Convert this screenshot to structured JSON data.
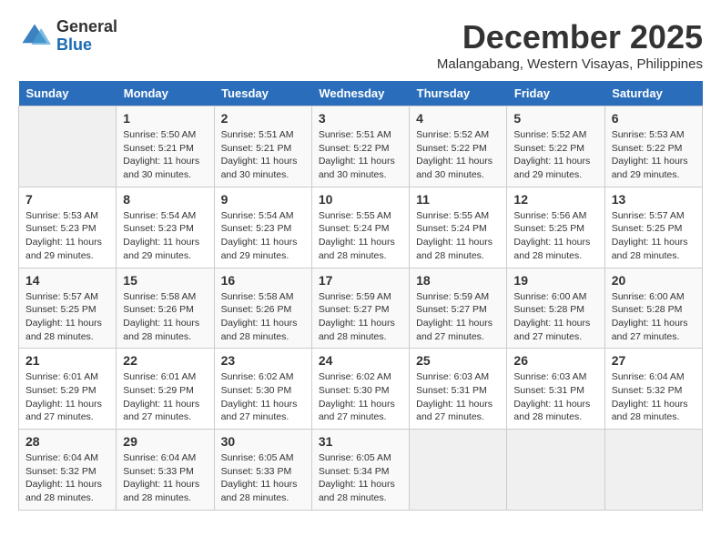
{
  "header": {
    "logo_general": "General",
    "logo_blue": "Blue",
    "month_title": "December 2025",
    "location": "Malangabang, Western Visayas, Philippines"
  },
  "days_of_week": [
    "Sunday",
    "Monday",
    "Tuesday",
    "Wednesday",
    "Thursday",
    "Friday",
    "Saturday"
  ],
  "weeks": [
    [
      {
        "day": "",
        "info": ""
      },
      {
        "day": "1",
        "info": "Sunrise: 5:50 AM\nSunset: 5:21 PM\nDaylight: 11 hours\nand 30 minutes."
      },
      {
        "day": "2",
        "info": "Sunrise: 5:51 AM\nSunset: 5:21 PM\nDaylight: 11 hours\nand 30 minutes."
      },
      {
        "day": "3",
        "info": "Sunrise: 5:51 AM\nSunset: 5:22 PM\nDaylight: 11 hours\nand 30 minutes."
      },
      {
        "day": "4",
        "info": "Sunrise: 5:52 AM\nSunset: 5:22 PM\nDaylight: 11 hours\nand 30 minutes."
      },
      {
        "day": "5",
        "info": "Sunrise: 5:52 AM\nSunset: 5:22 PM\nDaylight: 11 hours\nand 29 minutes."
      },
      {
        "day": "6",
        "info": "Sunrise: 5:53 AM\nSunset: 5:22 PM\nDaylight: 11 hours\nand 29 minutes."
      }
    ],
    [
      {
        "day": "7",
        "info": "Sunrise: 5:53 AM\nSunset: 5:23 PM\nDaylight: 11 hours\nand 29 minutes."
      },
      {
        "day": "8",
        "info": "Sunrise: 5:54 AM\nSunset: 5:23 PM\nDaylight: 11 hours\nand 29 minutes."
      },
      {
        "day": "9",
        "info": "Sunrise: 5:54 AM\nSunset: 5:23 PM\nDaylight: 11 hours\nand 29 minutes."
      },
      {
        "day": "10",
        "info": "Sunrise: 5:55 AM\nSunset: 5:24 PM\nDaylight: 11 hours\nand 28 minutes."
      },
      {
        "day": "11",
        "info": "Sunrise: 5:55 AM\nSunset: 5:24 PM\nDaylight: 11 hours\nand 28 minutes."
      },
      {
        "day": "12",
        "info": "Sunrise: 5:56 AM\nSunset: 5:25 PM\nDaylight: 11 hours\nand 28 minutes."
      },
      {
        "day": "13",
        "info": "Sunrise: 5:57 AM\nSunset: 5:25 PM\nDaylight: 11 hours\nand 28 minutes."
      }
    ],
    [
      {
        "day": "14",
        "info": "Sunrise: 5:57 AM\nSunset: 5:25 PM\nDaylight: 11 hours\nand 28 minutes."
      },
      {
        "day": "15",
        "info": "Sunrise: 5:58 AM\nSunset: 5:26 PM\nDaylight: 11 hours\nand 28 minutes."
      },
      {
        "day": "16",
        "info": "Sunrise: 5:58 AM\nSunset: 5:26 PM\nDaylight: 11 hours\nand 28 minutes."
      },
      {
        "day": "17",
        "info": "Sunrise: 5:59 AM\nSunset: 5:27 PM\nDaylight: 11 hours\nand 28 minutes."
      },
      {
        "day": "18",
        "info": "Sunrise: 5:59 AM\nSunset: 5:27 PM\nDaylight: 11 hours\nand 27 minutes."
      },
      {
        "day": "19",
        "info": "Sunrise: 6:00 AM\nSunset: 5:28 PM\nDaylight: 11 hours\nand 27 minutes."
      },
      {
        "day": "20",
        "info": "Sunrise: 6:00 AM\nSunset: 5:28 PM\nDaylight: 11 hours\nand 27 minutes."
      }
    ],
    [
      {
        "day": "21",
        "info": "Sunrise: 6:01 AM\nSunset: 5:29 PM\nDaylight: 11 hours\nand 27 minutes."
      },
      {
        "day": "22",
        "info": "Sunrise: 6:01 AM\nSunset: 5:29 PM\nDaylight: 11 hours\nand 27 minutes."
      },
      {
        "day": "23",
        "info": "Sunrise: 6:02 AM\nSunset: 5:30 PM\nDaylight: 11 hours\nand 27 minutes."
      },
      {
        "day": "24",
        "info": "Sunrise: 6:02 AM\nSunset: 5:30 PM\nDaylight: 11 hours\nand 27 minutes."
      },
      {
        "day": "25",
        "info": "Sunrise: 6:03 AM\nSunset: 5:31 PM\nDaylight: 11 hours\nand 27 minutes."
      },
      {
        "day": "26",
        "info": "Sunrise: 6:03 AM\nSunset: 5:31 PM\nDaylight: 11 hours\nand 28 minutes."
      },
      {
        "day": "27",
        "info": "Sunrise: 6:04 AM\nSunset: 5:32 PM\nDaylight: 11 hours\nand 28 minutes."
      }
    ],
    [
      {
        "day": "28",
        "info": "Sunrise: 6:04 AM\nSunset: 5:32 PM\nDaylight: 11 hours\nand 28 minutes."
      },
      {
        "day": "29",
        "info": "Sunrise: 6:04 AM\nSunset: 5:33 PM\nDaylight: 11 hours\nand 28 minutes."
      },
      {
        "day": "30",
        "info": "Sunrise: 6:05 AM\nSunset: 5:33 PM\nDaylight: 11 hours\nand 28 minutes."
      },
      {
        "day": "31",
        "info": "Sunrise: 6:05 AM\nSunset: 5:34 PM\nDaylight: 11 hours\nand 28 minutes."
      },
      {
        "day": "",
        "info": ""
      },
      {
        "day": "",
        "info": ""
      },
      {
        "day": "",
        "info": ""
      }
    ]
  ]
}
